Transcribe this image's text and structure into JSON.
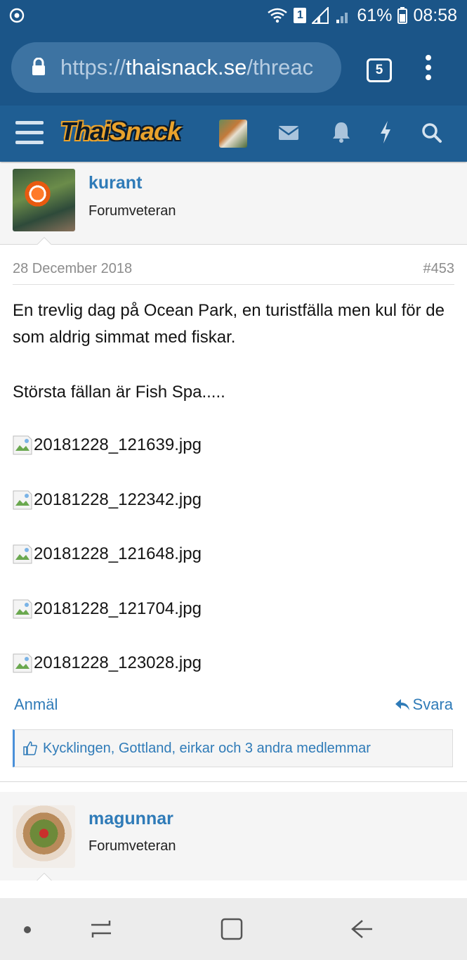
{
  "status_bar": {
    "sim_label": "1",
    "battery": "61%",
    "time": "08:58"
  },
  "browser": {
    "url_scheme": "https://",
    "url_host": "thaisnack.se",
    "url_path": "/threac",
    "tab_count": "5"
  },
  "site": {
    "logo_part1": "Thai",
    "logo_part2": "Snack"
  },
  "post": {
    "username": "kurant",
    "user_title": "Forumveteran",
    "date": "28 December 2018",
    "number": "#453",
    "line1": "En trevlig dag på Ocean Park, en turistfälla men kul för de som aldrig simmat med fiskar.",
    "line2": "Största fällan är Fish Spa.....",
    "images": [
      "20181228_121639.jpg",
      "20181228_122342.jpg",
      "20181228_121648.jpg",
      "20181228_121704.jpg",
      "20181228_123028.jpg"
    ],
    "report_label": "Anmäl",
    "reply_label": "Svara",
    "likes_text": "Kycklingen, Gottland, eirkar och 3 andra medlemmar"
  },
  "next_post": {
    "username": "magunnar",
    "user_title": "Forumveteran"
  },
  "colors": {
    "header_bg": "#1b5588",
    "link": "#2f7bb8"
  }
}
